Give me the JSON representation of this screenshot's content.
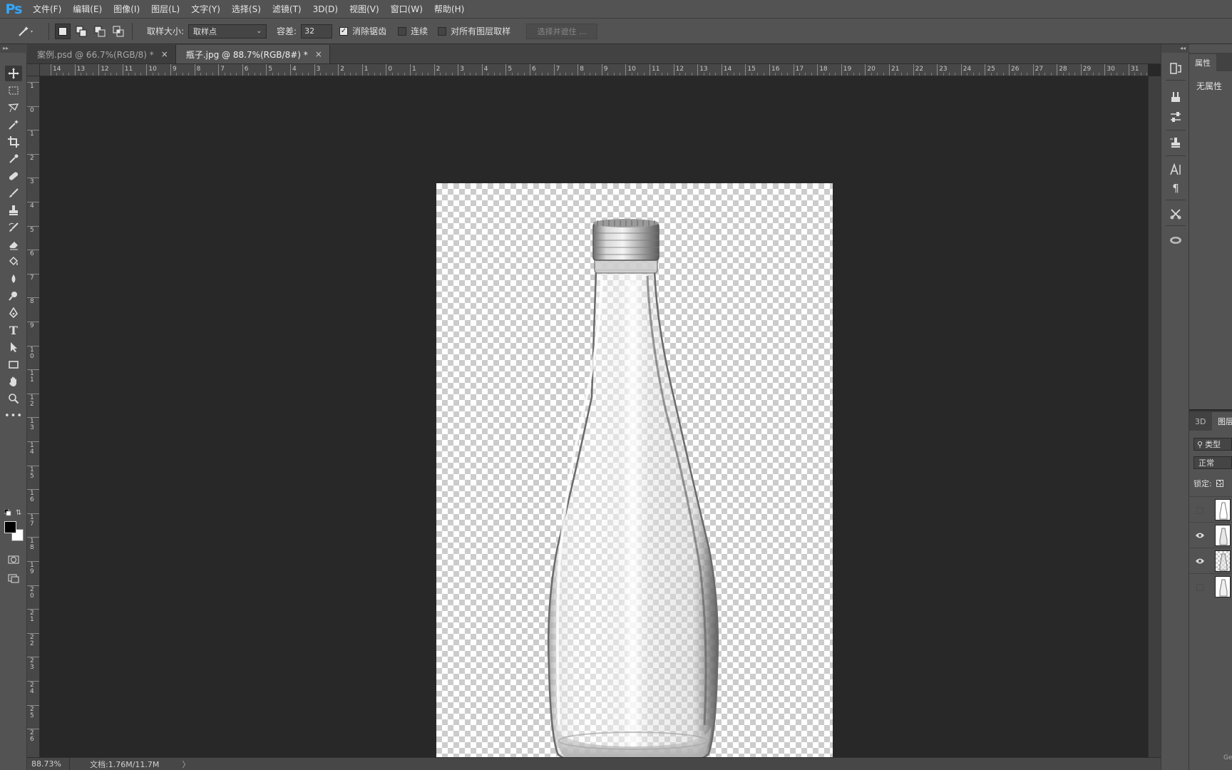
{
  "app": {
    "logo": "Ps"
  },
  "menu": [
    "文件(F)",
    "编辑(E)",
    "图像(I)",
    "图层(L)",
    "文字(Y)",
    "选择(S)",
    "滤镜(T)",
    "3D(D)",
    "视图(V)",
    "窗口(W)",
    "帮助(H)"
  ],
  "options": {
    "tool_icon": "magic-wand-icon",
    "sample_size_label": "取样大小:",
    "sample_size_value": "取样点",
    "tolerance_label": "容差:",
    "tolerance_value": "32",
    "anti_alias_label": "消除锯齿",
    "anti_alias_checked": true,
    "contiguous_label": "连续",
    "contiguous_checked": false,
    "all_layers_label": "对所有图层取样",
    "all_layers_checked": false,
    "select_mask_label": "选择并遮住 ..."
  },
  "tabs": [
    {
      "label": "案例.psd @ 66.7%(RGB/8) *",
      "close": "×",
      "active": false
    },
    {
      "label": "瓶子.jpg @ 88.7%(RGB/8#) *",
      "close": "×",
      "active": true
    }
  ],
  "ruler_top_labels": [
    "14",
    "13",
    "12",
    "11",
    "10",
    "9",
    "8",
    "7",
    "6",
    "5",
    "4",
    "3",
    "2",
    "1",
    "0",
    "1",
    "2",
    "3",
    "4",
    "5",
    "6",
    "7",
    "8",
    "9",
    "10",
    "11",
    "12",
    "13",
    "14",
    "15",
    "16",
    "17",
    "18",
    "19",
    "20",
    "21",
    "22",
    "23",
    "24",
    "25",
    "26",
    "27",
    "28",
    "29",
    "30",
    "31"
  ],
  "ruler_left_labels": [
    "1",
    "0",
    "1",
    "2",
    "3",
    "4",
    "5",
    "6",
    "7",
    "8",
    "9",
    "10",
    "11",
    "12",
    "13",
    "14",
    "15",
    "16",
    "17",
    "18",
    "19",
    "20",
    "21",
    "22",
    "23",
    "24",
    "25",
    "26"
  ],
  "status": {
    "zoom": "88.73%",
    "doc_info": "文档:1.76M/11.7M",
    "arrow": "〉"
  },
  "properties": {
    "tab_label": "属性",
    "empty_text": "无属性"
  },
  "layers": {
    "tab_3d": "3D",
    "tab_layers": "图层",
    "filter_label": "类型",
    "blend_mode": "正常",
    "lock_label": "锁定:",
    "rows": [
      {
        "visible": false
      },
      {
        "visible": true
      },
      {
        "visible": true
      },
      {
        "visible": false
      }
    ]
  },
  "corner_text": "Ge",
  "colors": {
    "foreground": "#000000",
    "background": "#ffffff",
    "ps_blue": "#31a8ff"
  }
}
